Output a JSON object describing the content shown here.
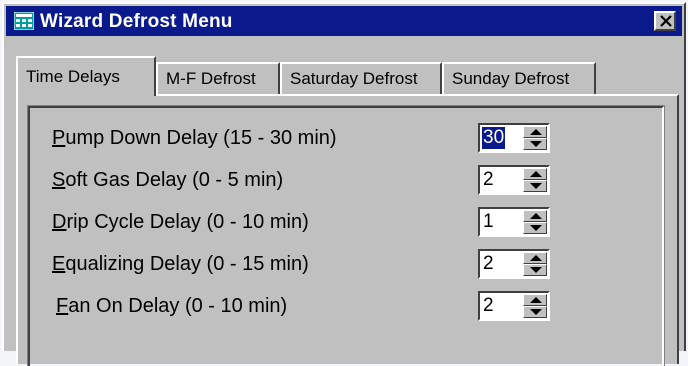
{
  "window": {
    "title": "Wizard Defrost Menu",
    "close_symbol": "X"
  },
  "tabs": [
    {
      "label": "Time Delays",
      "active": true
    },
    {
      "label": "M-F Defrost",
      "active": false
    },
    {
      "label": "Saturday Defrost",
      "active": false
    },
    {
      "label": "Sunday Defrost",
      "active": false
    }
  ],
  "fields": [
    {
      "hotkey": "P",
      "label_rest": "ump Down Delay (15 - 30 min)",
      "value": "30",
      "selected": true
    },
    {
      "hotkey": "S",
      "label_rest": "oft Gas Delay (0 - 5 min)",
      "value": "2",
      "selected": false
    },
    {
      "hotkey": "D",
      "label_rest": "rip Cycle Delay (0 - 10 min)",
      "value": "1",
      "selected": false
    },
    {
      "hotkey": "E",
      "label_rest": "qualizing Delay (0 - 15 min)",
      "value": "2",
      "selected": false
    },
    {
      "hotkey": "F",
      "label_rest": "an On Delay (0 - 10 min)",
      "value": "2",
      "selected": false
    }
  ],
  "colors": {
    "titlebar": "#0a1a8c",
    "face": "#c0c0c0",
    "selection": "#0a1a8c"
  },
  "icons": {
    "app": "calculator-grid-icon",
    "close": "close-icon",
    "spin_up": "arrow-up-icon",
    "spin_down": "arrow-down-icon"
  }
}
